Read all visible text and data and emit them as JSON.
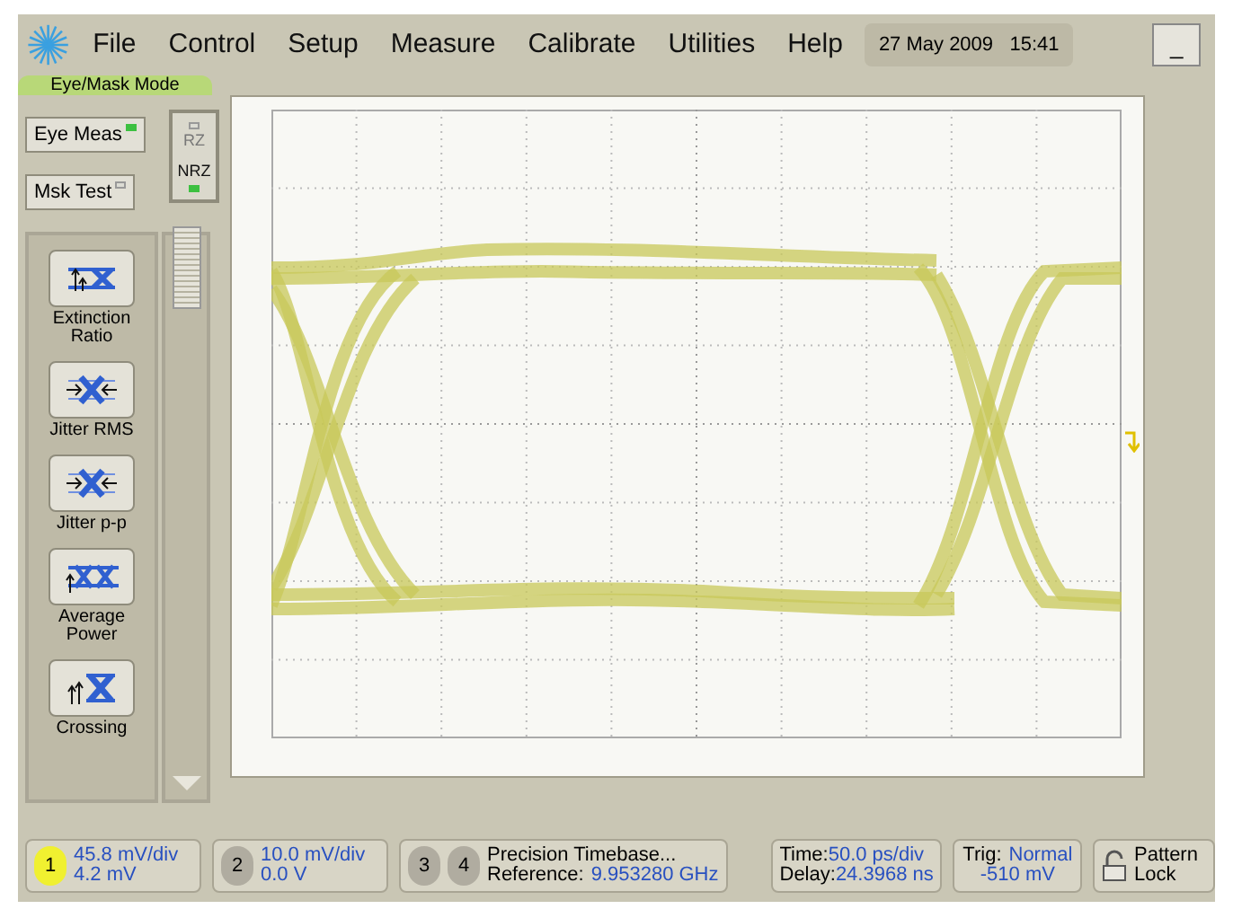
{
  "menu": [
    {
      "label": "File"
    },
    {
      "label": "Control"
    },
    {
      "label": "Setup"
    },
    {
      "label": "Measure"
    },
    {
      "label": "Calibrate"
    },
    {
      "label": "Utilities"
    },
    {
      "label": "Help"
    }
  ],
  "datetime": {
    "date": "27 May 2009",
    "time": "15:41"
  },
  "minimize": "_",
  "mode_tab": "Eye/Mask Mode",
  "mode_buttons": [
    {
      "label": "Eye Meas",
      "on": true
    },
    {
      "label": "Msk Test",
      "on": false
    }
  ],
  "format_toggle": [
    {
      "label": "RZ",
      "on": false
    },
    {
      "label": "NRZ",
      "on": true
    }
  ],
  "measurements": [
    {
      "label": "Extinction Ratio",
      "kind": "extinction"
    },
    {
      "label": "Jitter RMS",
      "kind": "jitter"
    },
    {
      "label": "Jitter p-p",
      "kind": "jitter"
    },
    {
      "label": "Average Power",
      "kind": "power"
    },
    {
      "label": "Crossing",
      "kind": "crossing"
    }
  ],
  "channels": [
    {
      "number": "1",
      "active": true,
      "scale": "45.8 mV/div",
      "offset": "4.2 mV"
    },
    {
      "number": "2",
      "active": false,
      "scale": "10.0 mV/div",
      "offset": "0.0 V"
    }
  ],
  "timebase": {
    "numbers": [
      "3",
      "4"
    ],
    "title": "Precision Timebase...",
    "reference_label": "Reference:",
    "reference": "9.953280 GHz"
  },
  "time": {
    "time_label": "Time:",
    "time": "50.0 ps/div",
    "delay_label": "Delay:",
    "delay": "24.3968 ns"
  },
  "trigger": {
    "label": "Trig:",
    "mode": "Normal",
    "level": "-510 mV"
  },
  "pattern_lock": {
    "label": "Pattern Lock",
    "locked": false
  }
}
